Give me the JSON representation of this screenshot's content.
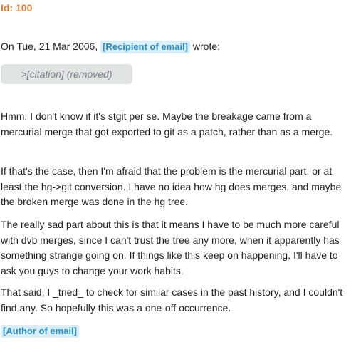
{
  "email": {
    "id_label": "Id: 100",
    "quote_intro_prefix": "On Tue, 21 Mar 2006,",
    "recipient_tag": "[Recipient of email]",
    "quote_intro_suffix": "wrote:",
    "citation_placeholder": ">[citation] (removed)",
    "paragraphs": [
      "Hmm. I don't know if it's stgit per se. Maybe the breakage came from a mercurial merge that got exported to git as a patch, rather than as a merge.",
      "If that's the case, then I'm afraid that the problem is the mercurial part, or at least the hg->git conversion. I have no idea how hg does merges, and maybe the broken merge was done in the hg tree.",
      "The really sad part about this is that it means I have to be much more careful with dvb merges, since I can't trust the tree any more, when it apparently has something strange going on. If things like this keep on happening, I'll have to ask you guys to change your work habits.",
      "That said, I _tried_ to check for similar cases in the past history, and I couldn't find any. So hopefully this was a one-off occurrence."
    ],
    "author_tag": "[Author of email]"
  },
  "colors": {
    "id_accent": "#e07b39",
    "tag_background": "#d9eef8",
    "tag_text": "#2a8fc4",
    "citation_background": "#e2e4e4",
    "citation_text": "#7a7f84",
    "body_text": "#1f1f1f"
  }
}
